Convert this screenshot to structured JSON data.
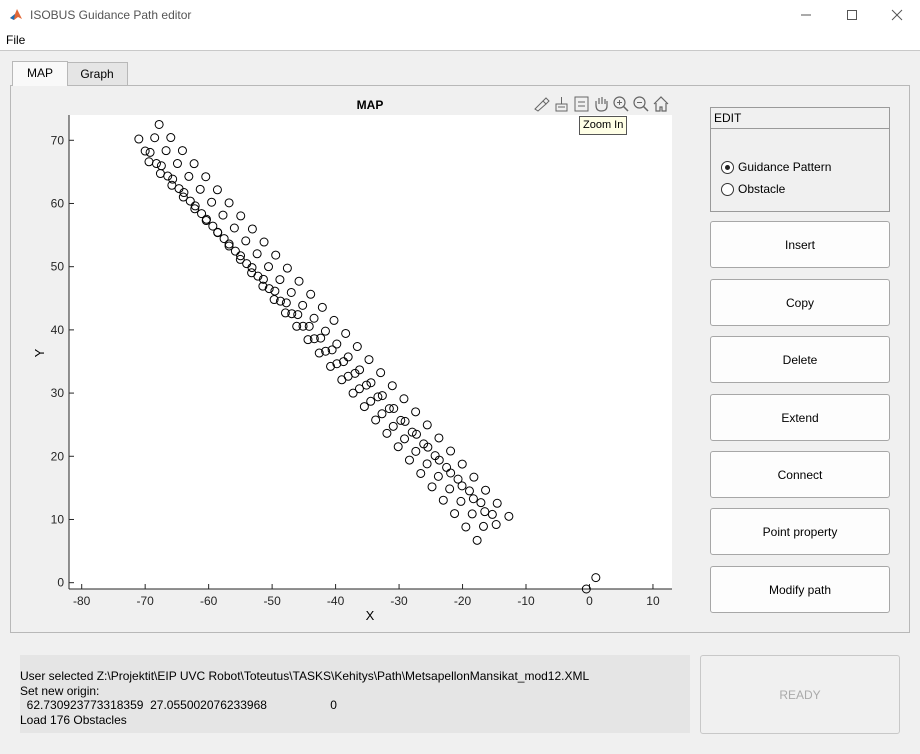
{
  "window": {
    "title": "ISOBUS Guidance Path editor"
  },
  "menu": {
    "file": "File"
  },
  "tabs": [
    {
      "label": "MAP"
    },
    {
      "label": "Graph"
    }
  ],
  "plot": {
    "title": "MAP",
    "toolbar_icons": [
      "brush-icon",
      "data-tips-icon",
      "legend-icon",
      "pan-icon",
      "zoom-in-icon",
      "zoom-out-icon",
      "home-icon"
    ],
    "tooltip": "Zoom In"
  },
  "edit": {
    "title": "EDIT",
    "options": [
      {
        "label": "Guidance Pattern",
        "selected": true
      },
      {
        "label": "Obstacle",
        "selected": false
      }
    ]
  },
  "buttons": {
    "insert": "Insert",
    "copy": "Copy",
    "delete": "Delete",
    "extend": "Extend",
    "connect": "Connect",
    "point_property": "Point property",
    "modify_path": "Modify path"
  },
  "status": {
    "line1": "User selected Z:\\Projektit\\EIP UVC Robot\\Toteutus\\TASKS\\Kehitys\\Path\\MetsapellonMansikat_mod12.XML",
    "line2": "Set new origin:",
    "line3": "  62.730923773318359  27.055002076233968                   0",
    "line4": "Load 176 Obstacles"
  },
  "ready": "READY",
  "chart_data": {
    "type": "scatter",
    "title": "MAP",
    "xlabel": "X",
    "ylabel": "Y",
    "xlim": [
      -82,
      13
    ],
    "ylim": [
      -1,
      74
    ],
    "xticks": [
      -80,
      -70,
      -60,
      -50,
      -40,
      -30,
      -20,
      -10,
      0,
      10
    ],
    "yticks": [
      0,
      10,
      20,
      30,
      40,
      50,
      60,
      70
    ],
    "grid": false,
    "marker": "open-circle",
    "rows": [
      {
        "start": [
          -71.0,
          70.2
        ],
        "end": [
          -17.7,
          6.7
        ]
      },
      {
        "start": [
          -70.0,
          68.3
        ],
        "end": [
          -16.7,
          8.9
        ]
      },
      {
        "start": [
          -69.4,
          66.6
        ],
        "end": [
          -15.3,
          10.8
        ]
      },
      {
        "start": [
          -68.5,
          70.4
        ],
        "end": [
          -14.7,
          9.2
        ]
      },
      {
        "start": [
          -67.8,
          72.5
        ],
        "end": [
          -12.7,
          10.5
        ]
      }
    ],
    "points_per_row": 31,
    "extra_points": [
      {
        "x": -0.5,
        "y": -1.0
      },
      {
        "x": 1.0,
        "y": 0.8
      }
    ]
  }
}
